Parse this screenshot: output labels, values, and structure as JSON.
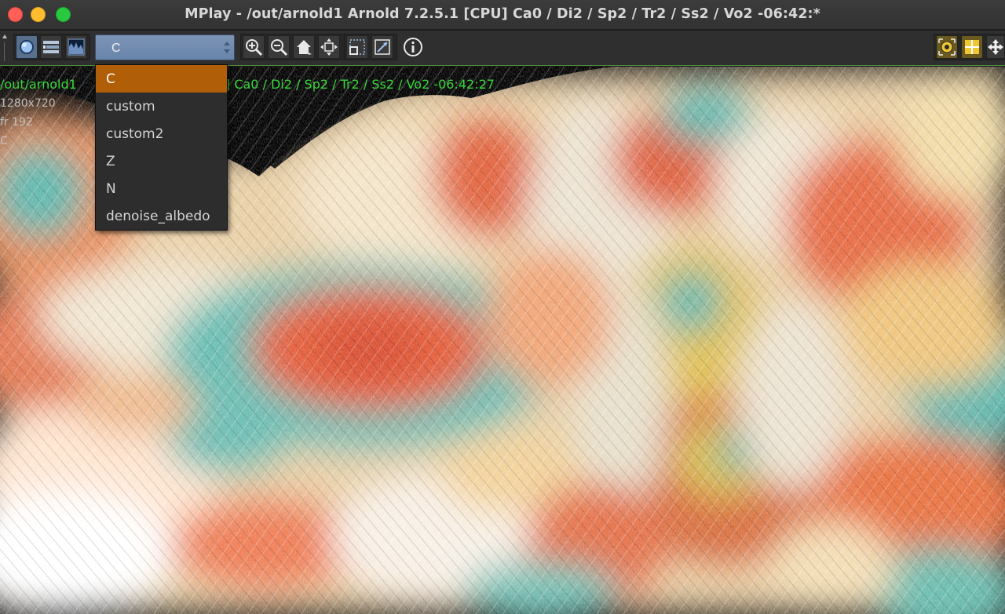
{
  "window": {
    "title": "MPlay - /out/arnold1   Arnold 7.2.5.1 [CPU]  Ca0 / Di2 / Sp2 / Tr2 / Ss2 / Vo2 -06:42:*"
  },
  "toolbar": {
    "plane_select": {
      "value": "C",
      "options": [
        "C",
        "custom",
        "custom2",
        "Z",
        "N",
        "denoise_albedo"
      ],
      "selected_index": 0
    },
    "buttons": [
      {
        "icon": "sphere-preview-icon"
      },
      {
        "icon": "layers-list-icon"
      },
      {
        "icon": "histogram-icon"
      },
      {
        "icon": "zoom-in-icon"
      },
      {
        "icon": "zoom-out-icon"
      },
      {
        "icon": "home-icon"
      },
      {
        "icon": "fit-frame-icon"
      },
      {
        "icon": "region-select-icon"
      },
      {
        "icon": "region-edit-icon"
      },
      {
        "icon": "info-icon"
      },
      {
        "icon": "snapshot-target-icon"
      },
      {
        "icon": "grid-icon"
      },
      {
        "icon": "move-arrows-icon"
      }
    ]
  },
  "viewport": {
    "overlay": {
      "path": "/out/arnold1",
      "stats": "]  Ca0 / Di2 / Sp2 / Tr2 / Ss2 / Vo2 -06:42:27",
      "resolution": "1280x720",
      "frame": "fr 192",
      "plane": "C"
    }
  },
  "colors": {
    "overlay_text": "#39d83a",
    "selected_item": "#b05e08",
    "plane_select_bg": "#7d95b6"
  }
}
